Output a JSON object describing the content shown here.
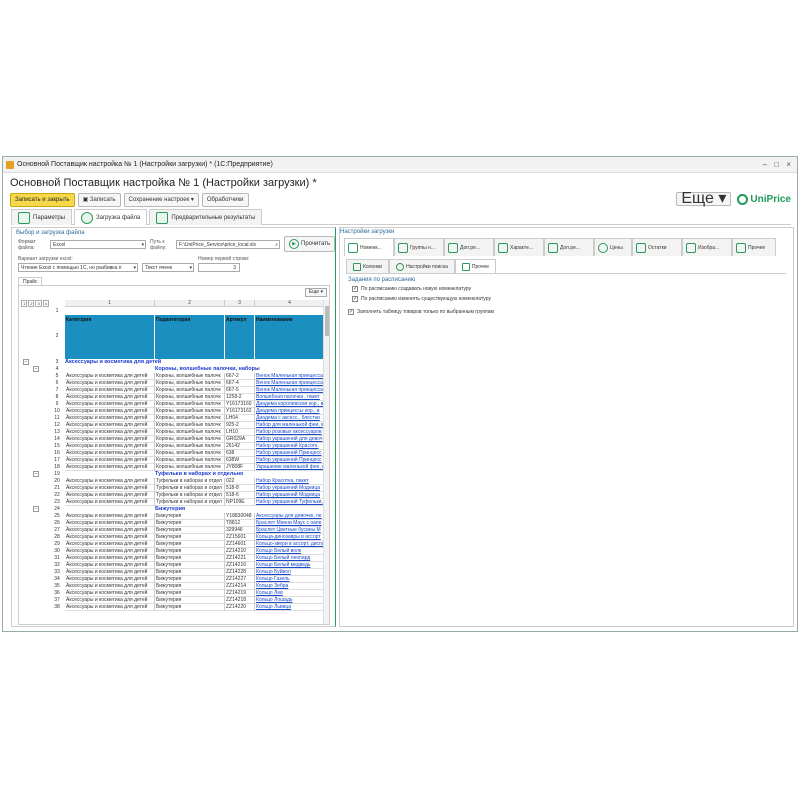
{
  "window": {
    "title": "Основной Поставщик настройка № 1 (Настройки загрузки) * (1С:Предприятие)",
    "page_title": "Основной Поставщик настройка № 1 (Настройки загрузки) *"
  },
  "toolbar": {
    "save_close": "Записать и закрыть",
    "save": "Записать",
    "save_settings": "Сохранение настроек",
    "handlers": "Обработчики",
    "more": "Еще"
  },
  "brand": "UniPrice",
  "main_tabs": [
    "Параметры",
    "Загрузка файла",
    "Предварительные результаты"
  ],
  "left": {
    "section_title": "Выбор и загрузка файла",
    "format_label": "Формат файла:",
    "format_value": "Excel",
    "path_label": "Путь к файлу:",
    "path_value": "F:\\UniPrice_Service\\price_local.xls",
    "read_button": "Прочитать",
    "variant_label": "Вариант загрузки excel:",
    "variant_value": "Чтение Excel с помощью 1С, но разбивка п",
    "text_label": "Текст ячеек:",
    "text_value": "Текст ячеек",
    "first_row_label": "Номер первой строки:",
    "first_row_value": "3",
    "sheet_tab": "Прайс",
    "sheet_more": "Еще"
  },
  "sheet": {
    "level_buttons": [
      "1",
      "2",
      "3",
      "4"
    ],
    "col_numbers": [
      "1",
      "2",
      "3",
      "4"
    ],
    "header": {
      "row": "2",
      "c1": "Категория",
      "c2": "Подкатегория",
      "c3": "Артикул",
      "c4": "Наименование"
    },
    "rows": [
      {
        "n": "3",
        "group": "Аксессуары и косметика для детей"
      },
      {
        "n": "4",
        "group": "Короны, волшебные палочки, наборы"
      },
      {
        "n": "5",
        "c1": "Аксессуары и косметика для детей",
        "c2": "Короны, волшебные палочк",
        "c3": "667-2",
        "c4": "Венок Маленькая принцесса"
      },
      {
        "n": "6",
        "c1": "Аксессуары и косметика для детей",
        "c2": "Короны, волшебные палочк",
        "c3": "667-4",
        "c4": "Венок Маленькая принцесса"
      },
      {
        "n": "7",
        "c1": "Аксессуары и косметика для детей",
        "c2": "Короны, волшебные палочк",
        "c3": "667-5",
        "c4": "Венок Маленькая принцесса"
      },
      {
        "n": "8",
        "c1": "Аксессуары и косметика для детей",
        "c2": "Короны, волшебные палочк",
        "c3": "1258-2",
        "c4": "Волшебная палочка , пакет"
      },
      {
        "n": "9",
        "c1": "Аксессуары и косметика для детей",
        "c2": "Короны, волшебные палочк",
        "c3": "Y16173160",
        "c4": "Диадема королевская кор., в"
      },
      {
        "n": "10",
        "c1": "Аксессуары и косметика для детей",
        "c2": "Короны, волшебные палочк",
        "c3": "Y16173162",
        "c4": "Диадема принцессы кор., в"
      },
      {
        "n": "11",
        "c1": "Аксессуары и косметика для детей",
        "c2": "Короны, волшебные палочк",
        "c3": "LH04",
        "c4": "Диадема с аксесс., блестки"
      },
      {
        "n": "12",
        "c1": "Аксессуары и косметика для детей",
        "c2": "Короны, волшебные палочк",
        "c3": "925-2",
        "c4": "Набор для маленькой феи, в"
      },
      {
        "n": "13",
        "c1": "Аксессуары и косметика для детей",
        "c2": "Короны, волшебные палочк",
        "c3": "LH10",
        "c4": "Набор розовых аксессуаров"
      },
      {
        "n": "14",
        "c1": "Аксессуары и косметика для детей",
        "c2": "Короны, волшебные палочк",
        "c3": "GR029A",
        "c4": "Набор украшений для девоч"
      },
      {
        "n": "15",
        "c1": "Аксессуары и косметика для детей",
        "c2": "Короны, волшебные палочк",
        "c3": "26142",
        "c4": "Набор украшений Красотк."
      },
      {
        "n": "16",
        "c1": "Аксессуары и косметика для детей",
        "c2": "Короны, волшебные палочк",
        "c3": "638",
        "c4": "Набор украшений Принцесс"
      },
      {
        "n": "17",
        "c1": "Аксессуары и косметика для детей",
        "c2": "Короны, волшебные палочк",
        "c3": "638W",
        "c4": "Набор украшений Принцесс"
      },
      {
        "n": "18",
        "c1": "Аксессуары и косметика для детей",
        "c2": "Короны, волшебные палочк",
        "c3": "JY808F",
        "c4": "Украшение маленькой фее, н"
      },
      {
        "n": "19",
        "group": "Туфельки в наборах и отдельно"
      },
      {
        "n": "20",
        "c1": "Аксессуары и косметика для детей",
        "c2": "Туфельки в наборах и отдел",
        "c3": "022",
        "c4": "Набор Красотка, пакет"
      },
      {
        "n": "21",
        "c1": "Аксессуары и косметика для детей",
        "c2": "Туфельки в наборах и отдел",
        "c3": "518-8",
        "c4": "Набор украшений Модница"
      },
      {
        "n": "22",
        "c1": "Аксессуары и косметика для детей",
        "c2": "Туфельки в наборах и отдел",
        "c3": "518-6",
        "c4": "Набор украшений Модница"
      },
      {
        "n": "23",
        "c1": "Аксессуары и косметика для детей",
        "c2": "Туфельки в наборах и отдел",
        "c3": "NP109E",
        "c4": "Набор украшений Туфельки,"
      },
      {
        "n": "24",
        "group": "Бижутерия"
      },
      {
        "n": "25",
        "c1": "Аксессуары и косметика для детей",
        "c2": "Бижутерия",
        "c3": "Y18830048",
        "c4": "Аксессуары для девочек, пе"
      },
      {
        "n": "26",
        "c1": "Аксессуары и косметика для детей",
        "c2": "Бижутерия",
        "c3": "T8812",
        "c4": "Браслет Минни Маус с напе"
      },
      {
        "n": "27",
        "c1": "Аксессуары и косметика для детей",
        "c2": "Бижутерия",
        "c3": "329946",
        "c4": "Браслет Цветные бусины М"
      },
      {
        "n": "28",
        "c1": "Аксессуары и косметика для детей",
        "c2": "Бижутерия",
        "c3": "ZZ15601",
        "c4": "Кольца-динозавры в ассорт"
      },
      {
        "n": "29",
        "c1": "Аксессуары и косметика для детей",
        "c2": "Бижутерия",
        "c3": "ZZ14601",
        "c4": "Кольцо-звери в ассорт, диспл"
      },
      {
        "n": "30",
        "c1": "Аксессуары и косметика для детей",
        "c2": "Бижутерия",
        "c3": "ZZ14210",
        "c4": "Кольцо Белый волк"
      },
      {
        "n": "31",
        "c1": "Аксессуары и косметика для детей",
        "c2": "Бижутерия",
        "c3": "ZZ14221",
        "c4": "Кольцо Белый леопард"
      },
      {
        "n": "32",
        "c1": "Аксессуары и косметика для детей",
        "c2": "Бижутерия",
        "c3": "ZZ14216",
        "c4": "Кольцо Белый медведь"
      },
      {
        "n": "33",
        "c1": "Аксессуары и косметика для детей",
        "c2": "Бижутерия",
        "c3": "ZZ14228",
        "c4": "Кольцо Буйвол"
      },
      {
        "n": "34",
        "c1": "Аксессуары и косметика для детей",
        "c2": "Бижутерия",
        "c3": "ZZ14227",
        "c4": "Кольцо Газель"
      },
      {
        "n": "35",
        "c1": "Аксессуары и косметика для детей",
        "c2": "Бижутерия",
        "c3": "ZZ14214",
        "c4": "Кольцо Зебра"
      },
      {
        "n": "36",
        "c1": "Аксессуары и косметика для детей",
        "c2": "Бижутерия",
        "c3": "ZZ14219",
        "c4": "Кольцо Лев"
      },
      {
        "n": "37",
        "c1": "Аксессуары и косметика для детей",
        "c2": "Бижутерия",
        "c3": "ZZ14218",
        "c4": "Кольцо Лошадь"
      },
      {
        "n": "38",
        "c1": "Аксессуары и косметика для детей",
        "c2": "Бижутерия",
        "c3": "ZZ14220",
        "c4": "Кольцо Львица"
      }
    ]
  },
  "right": {
    "section_title": "Настройки загрузки",
    "tabs": [
      "Номенк...",
      "Группы н...",
      "Доп.ре...",
      "Характе...",
      "Доп.ре...",
      "Цены",
      "Остатки",
      "Изобра...",
      "Прочее"
    ],
    "sub_tabs": [
      "Колонки",
      "Настройки поиска",
      "Прочее"
    ],
    "schedule_title": "Задания по расписанию",
    "checkboxes": [
      "По расписанию создавать новую номенклатуру",
      "По расписанию изменять существующую номенклатуру",
      "Заполнять таблицу товаров только по выбранным группам"
    ]
  },
  "colors": {
    "accent_green": "#2b9a5a",
    "header_blue": "#1a8fc0",
    "link_blue": "#1a4acc",
    "primary_yellow": "#f7d84a"
  }
}
